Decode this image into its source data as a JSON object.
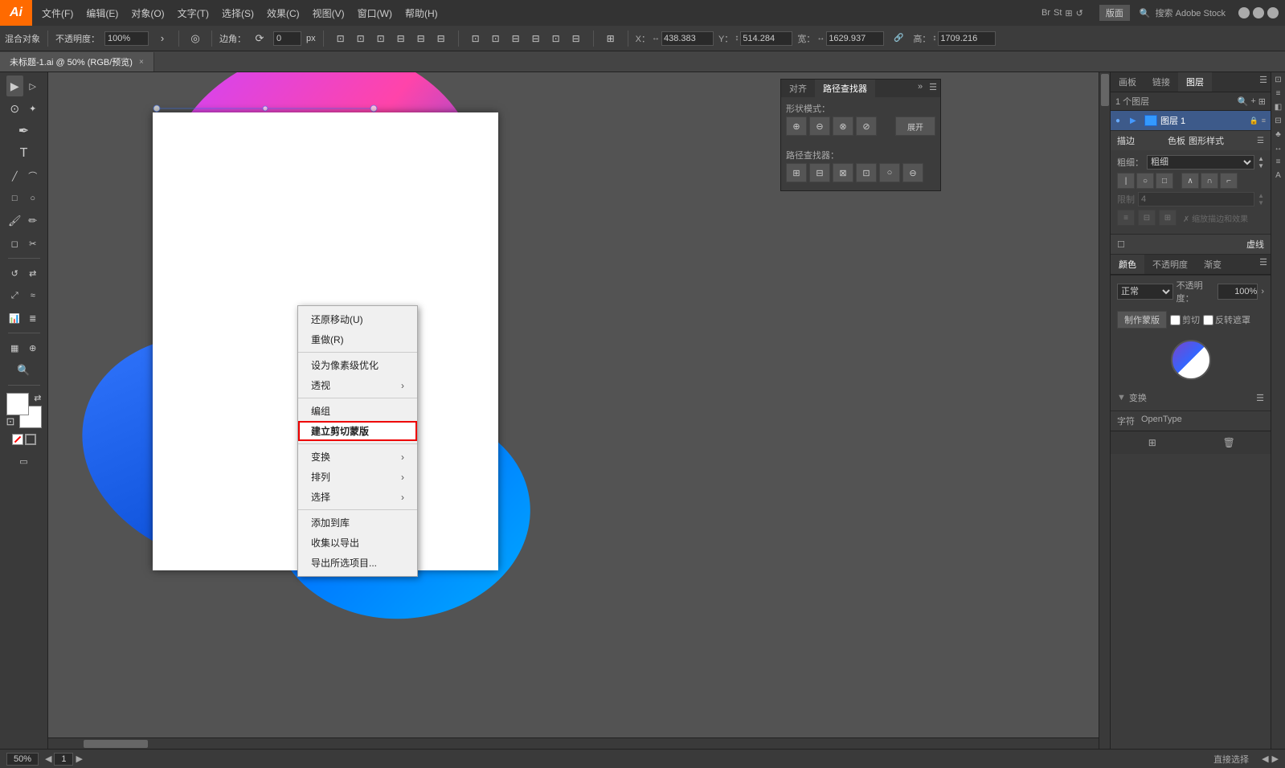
{
  "app": {
    "logo": "Ai",
    "version_badge": "版面",
    "title": "未标题-1.ai @ 50% (RGB/预览)"
  },
  "menu": {
    "items": [
      "文件(F)",
      "编辑(E)",
      "对象(O)",
      "文字(T)",
      "选择(S)",
      "效果(C)",
      "视图(V)",
      "窗口(W)",
      "帮助(H)"
    ]
  },
  "options_bar": {
    "blend_label": "混合对象",
    "opacity_label": "不透明度：",
    "opacity_value": "100%",
    "angle_label": "边角：",
    "angle_value": "0",
    "angle_unit": "px",
    "x_label": "X：",
    "x_value": "438.383",
    "y_label": "Y：",
    "y_value": "514.284",
    "w_label": "宽：",
    "w_value": "1629.937",
    "h_label": "高：",
    "h_value": "1709.216"
  },
  "tab": {
    "name": "未标题-1.ai @ 50% (RGB/预览)"
  },
  "context_menu": {
    "items": [
      {
        "label": "还原移动(U)",
        "shortcut": "",
        "has_arrow": false,
        "disabled": false,
        "highlighted": false
      },
      {
        "label": "重做(R)",
        "shortcut": "",
        "has_arrow": false,
        "disabled": false,
        "highlighted": false
      },
      {
        "label": "设为像素级优化",
        "shortcut": "",
        "has_arrow": false,
        "disabled": false,
        "highlighted": false
      },
      {
        "label": "透视",
        "shortcut": "",
        "has_arrow": true,
        "disabled": false,
        "highlighted": false
      },
      {
        "label": "编组",
        "shortcut": "",
        "has_arrow": false,
        "disabled": false,
        "highlighted": false
      },
      {
        "label": "建立剪切蒙版",
        "shortcut": "",
        "has_arrow": false,
        "disabled": false,
        "highlighted": true
      },
      {
        "label": "变换",
        "shortcut": "",
        "has_arrow": true,
        "disabled": false,
        "highlighted": false
      },
      {
        "label": "排列",
        "shortcut": "",
        "has_arrow": true,
        "disabled": false,
        "highlighted": false
      },
      {
        "label": "选择",
        "shortcut": "",
        "has_arrow": true,
        "disabled": false,
        "highlighted": false
      },
      {
        "label": "添加到库",
        "shortcut": "",
        "has_arrow": false,
        "disabled": false,
        "highlighted": false
      },
      {
        "label": "收集以导出",
        "shortcut": "",
        "has_arrow": false,
        "disabled": false,
        "highlighted": false
      },
      {
        "label": "导出所选项目...",
        "shortcut": "",
        "has_arrow": false,
        "disabled": false,
        "highlighted": false
      }
    ]
  },
  "floating_panel": {
    "tabs": [
      "对齐",
      "路径查找器"
    ],
    "active_tab": "路径查找器",
    "shape_modes_label": "形状模式：",
    "pathfinder_label": "路径查找器："
  },
  "layers_panel": {
    "tabs": [
      "画板",
      "链接",
      "图层"
    ],
    "active_tab": "图层",
    "layer_name": "图层 1",
    "layer_count": "1 个图层"
  },
  "right_panel": {
    "stroke_section": "描边",
    "color_section": "色板",
    "style_section": "图形样式",
    "width_label": "粗细：",
    "dashes_label": "虚线",
    "blending_label": "颜色",
    "transparency_label": "不透明度",
    "gradient_label": "渐变",
    "blending_mode": "正常",
    "opacity_value": "100%",
    "mask_btn": "制作蒙版",
    "transform_label": "变换",
    "character_label": "字符",
    "opentype_label": "OpenType"
  },
  "status_bar": {
    "zoom": "50%",
    "status": "直接选择",
    "nav_prev": "◀",
    "nav_next": "▶",
    "page_num": "1"
  }
}
